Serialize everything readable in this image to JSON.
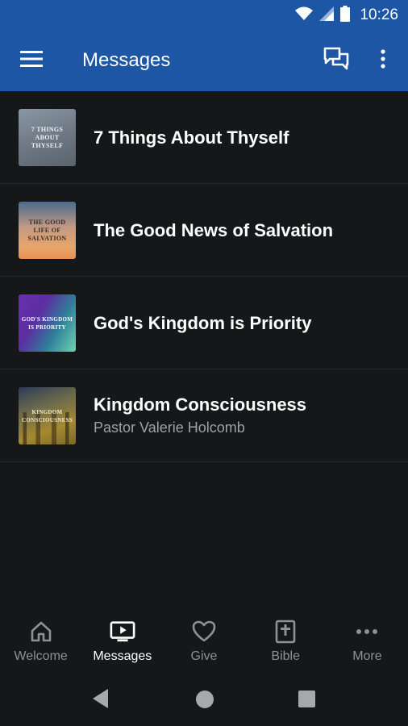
{
  "status_bar": {
    "time": "10:26"
  },
  "app_bar": {
    "title": "Messages"
  },
  "messages": [
    {
      "title": "7 Things About Thyself",
      "subtitle": "",
      "thumb_text": "7 THINGS ABOUT THYSELF"
    },
    {
      "title": "The Good News of Salvation",
      "subtitle": "",
      "thumb_text": "THE GOOD LIFE OF SALVATION"
    },
    {
      "title": "God's Kingdom is Priority",
      "subtitle": "",
      "thumb_text": "GOD'S KINGDOM IS PRIORITY"
    },
    {
      "title": "Kingdom Consciousness",
      "subtitle": "Pastor Valerie Holcomb",
      "thumb_text": "KINGDOM CONSCIOUSNESS"
    }
  ],
  "bottom_nav": {
    "active": "Messages",
    "items": [
      {
        "label": "Welcome",
        "icon": "home-icon"
      },
      {
        "label": "Messages",
        "icon": "tv-play-icon"
      },
      {
        "label": "Give",
        "icon": "heart-icon"
      },
      {
        "label": "Bible",
        "icon": "bible-icon"
      },
      {
        "label": "More",
        "icon": "more-dots-icon"
      }
    ]
  },
  "colors": {
    "app_bar": "#1d56a4",
    "background": "#161719",
    "active_nav": "#ffffff",
    "inactive_nav": "#8e9094"
  }
}
